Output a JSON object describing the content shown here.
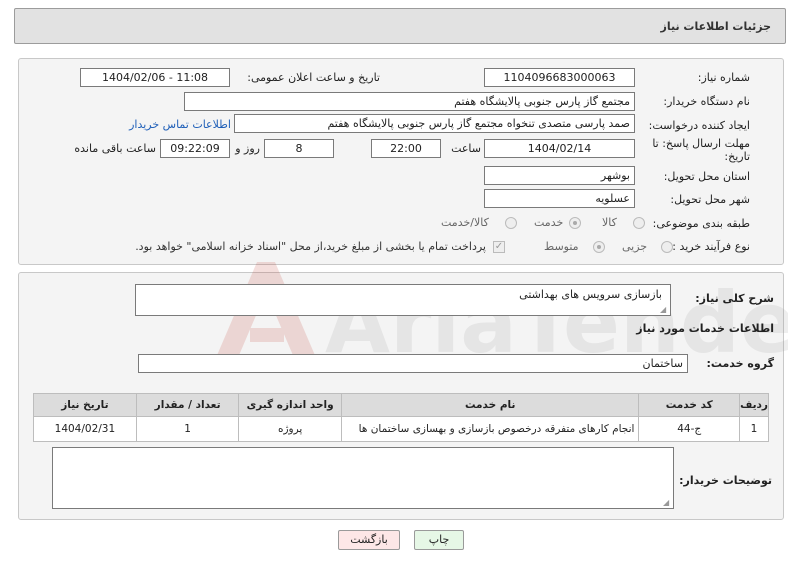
{
  "header": {
    "title": "جزئیات اطلاعات نیاز"
  },
  "fields": {
    "need_number_label": "شماره نیاز:",
    "need_number": "1104096683000063",
    "announce_label": "تاریخ و ساعت اعلان عمومی:",
    "announce_value": "1404/02/06 - 11:08",
    "buyer_org_label": "نام دستگاه خریدار:",
    "buyer_org": "مجتمع گاز پارس جنوبی  پالایشگاه هفتم",
    "creator_label": "ایجاد کننده درخواست:",
    "creator": "صمد پارسی متصدی تنخواه مجتمع گاز پارس جنوبی  پالایشگاه هفتم",
    "contact_link": "اطلاعات تماس خریدار",
    "deadline_label_line1": "مهلت ارسال پاسخ: تا",
    "deadline_label_line2": "تاریخ:",
    "deadline_date": "1404/02/14",
    "time_label": "ساعت",
    "deadline_time": "22:00",
    "days_value": "8",
    "days_label": "روز و",
    "remaining_time": "09:22:09",
    "remaining_label": "ساعت باقی مانده",
    "province_label": "استان محل تحویل:",
    "province": "بوشهر",
    "city_label": "شهر محل تحویل:",
    "city": "عسلویه",
    "category_label": "طبقه بندی موضوعی:",
    "category_options": [
      "کالا",
      "خدمت",
      "کالا/خدمت"
    ],
    "category_selected": "خدمت",
    "process_label": "نوع فرآیند خرید :",
    "process_options": [
      "جزیی",
      "متوسط"
    ],
    "process_selected": "متوسط",
    "payment_note": "پرداخت تمام یا بخشی از مبلغ خرید،از محل \"اسناد خزانه اسلامی\" خواهد بود."
  },
  "description": {
    "label": "شرح کلی نیاز:",
    "value": "بازسازی سرویس های بهداشتی"
  },
  "services": {
    "section_title": "اطلاعات خدمات مورد نیاز",
    "group_label": "گروه خدمت:",
    "group_value": "ساختمان",
    "columns": [
      "ردیف",
      "کد خدمت",
      "نام خدمت",
      "واحد اندازه گیری",
      "تعداد / مقدار",
      "تاریخ نیاز"
    ],
    "rows": [
      {
        "row": "1",
        "code": "ج-44",
        "name": "انجام کارهای متفرقه درخصوص بازسازی و بهسازی ساختمان ها",
        "unit": "پروژه",
        "qty": "1",
        "date": "1404/02/31"
      }
    ]
  },
  "buyer_notes": {
    "label": "توضیحات خریدار:",
    "value": ""
  },
  "buttons": {
    "print": "چاپ",
    "back": "بازگشت"
  },
  "watermark": {
    "text": "AriaTender.neT"
  },
  "colors": {
    "link": "#1f5fb8",
    "back_button_bg": "#fde7e7",
    "print_button_bg": "#e6f7e6",
    "watermark": "#c0392b"
  }
}
